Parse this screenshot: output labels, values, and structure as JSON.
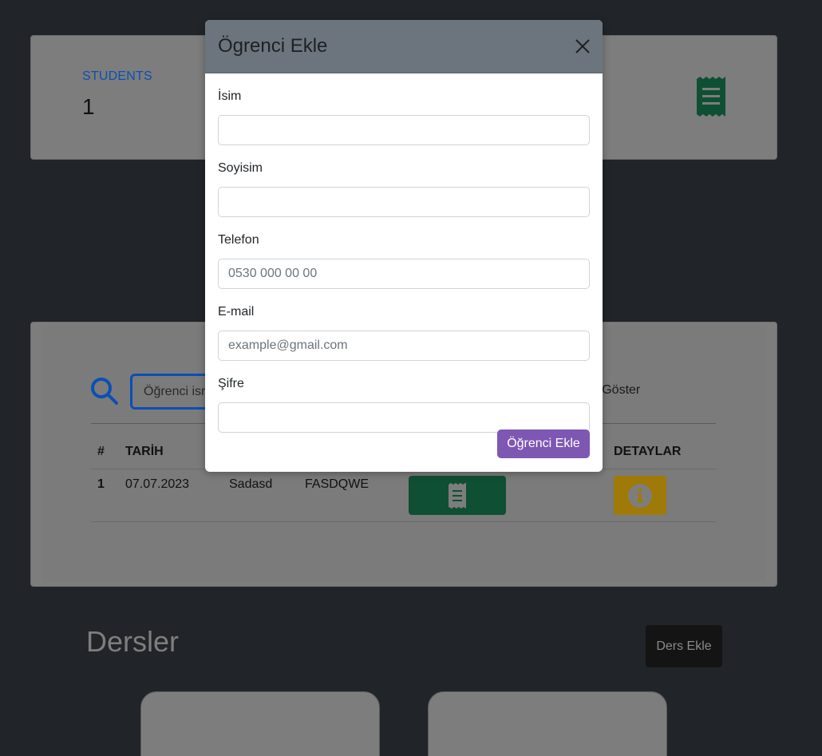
{
  "stats": {
    "label": "STUDENTS",
    "value": "1"
  },
  "search": {
    "placeholder": "Öğrenci isr",
    "show_text": "rı Göster"
  },
  "table": {
    "headers": [
      "#",
      "TARİH",
      "DETAYLAR"
    ],
    "rows": [
      {
        "num": "1",
        "date": "07.07.2023",
        "first": "Sadasd",
        "last": "FASDQWE"
      }
    ]
  },
  "courses": {
    "title": "Dersler",
    "add_label": "Ders Ekle"
  },
  "modal": {
    "title": "Ögrenci Ekle",
    "fields": [
      {
        "label": "İsim",
        "placeholder": ""
      },
      {
        "label": "Soyisim",
        "placeholder": ""
      },
      {
        "label": "Telefon",
        "placeholder": "0530 000 00 00"
      },
      {
        "label": "E-mail",
        "placeholder": "example@gmail.com"
      },
      {
        "label": "Şifre",
        "placeholder": ""
      }
    ],
    "submit_label": "Öğrenci Ekle"
  },
  "colors": {
    "accent_blue": "#0b4fb2",
    "success_green": "#198754",
    "warning_yellow": "#ffc107",
    "submit_purple": "#7e57b3",
    "modal_header": "#6c757d"
  },
  "icons": [
    "receipt-icon",
    "search-icon",
    "info-icon",
    "close-icon"
  ]
}
